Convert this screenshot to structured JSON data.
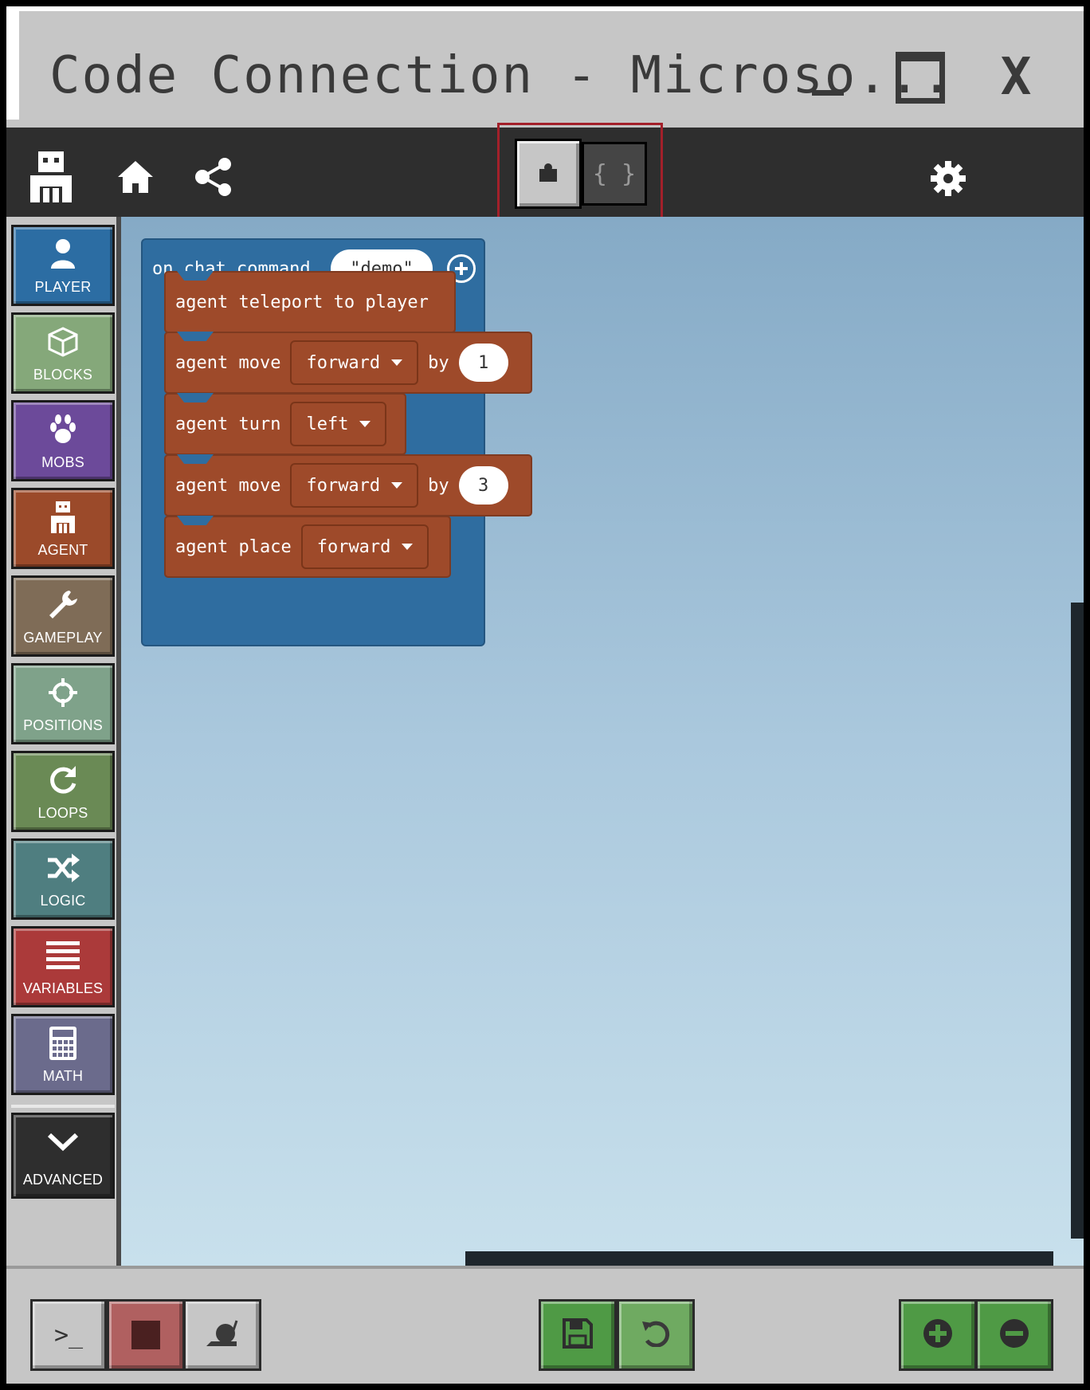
{
  "window": {
    "title": "Code Connection - Microso...",
    "controls": {
      "minimize": "minimize",
      "maximize": "maximize",
      "close": "X"
    }
  },
  "header": {
    "editor_modes": {
      "blocks": "blocks",
      "javascript": "{ }",
      "active": "blocks"
    },
    "ms_logo_colors": [
      "#b3573f",
      "#7ea747",
      "#3e9ac9",
      "#d4b24d"
    ]
  },
  "toolbox": {
    "categories": [
      {
        "label": "PLAYER",
        "color": "#2c6da3",
        "icon": "person-icon"
      },
      {
        "label": "BLOCKS",
        "color": "#85a87a",
        "icon": "cube-icon"
      },
      {
        "label": "MOBS",
        "color": "#6c4a9a",
        "icon": "paw-icon"
      },
      {
        "label": "AGENT",
        "color": "#9b4a2a",
        "icon": "agent-icon"
      },
      {
        "label": "GAMEPLAY",
        "color": "#7f6c57",
        "icon": "wrench-icon"
      },
      {
        "label": "POSITIONS",
        "color": "#7fa28a",
        "icon": "crosshair-icon"
      },
      {
        "label": "LOOPS",
        "color": "#6a8a55",
        "icon": "refresh-icon"
      },
      {
        "label": "LOGIC",
        "color": "#4f7e80",
        "icon": "shuffle-icon"
      },
      {
        "label": "VARIABLES",
        "color": "#ab3a3a",
        "icon": "list-icon"
      },
      {
        "label": "MATH",
        "color": "#6b6b8c",
        "icon": "calculator-icon"
      }
    ],
    "advanced": {
      "label": "ADVANCED",
      "color": "#2e2e2e",
      "icon": "chevron-down-icon"
    }
  },
  "workspace": {
    "event": {
      "label": "on chat command",
      "arg": "\"demo\""
    },
    "statements": [
      {
        "text": "agent teleport to player"
      },
      {
        "text": "agent move",
        "dropdown": "forward",
        "by": "by",
        "value": "1"
      },
      {
        "text": "agent turn",
        "dropdown": "left"
      },
      {
        "text": "agent move",
        "dropdown": "forward",
        "by": "by",
        "value": "3"
      },
      {
        "text": "agent place",
        "dropdown": "forward"
      }
    ]
  },
  "bottom": {
    "console": ">_",
    "stop": "stop",
    "slow": "slow",
    "save": "save",
    "undo": "undo",
    "zoom_in": "zoom-in",
    "zoom_out": "zoom-out"
  }
}
